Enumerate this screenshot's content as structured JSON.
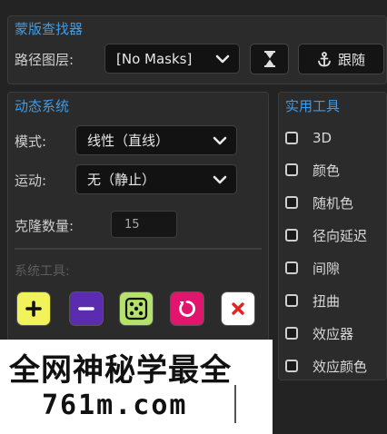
{
  "mask_finder": {
    "title": "蒙版查找器",
    "path_layer_label": "路径图层:",
    "path_layer_value": "[No Masks]",
    "follow_button": "跟随"
  },
  "dynamics": {
    "title": "动态系统",
    "mode_label": "模式:",
    "mode_value": "线性（直线）",
    "motion_label": "运动:",
    "motion_value": "无（静止）",
    "clone_label": "克隆数量:",
    "clone_value": "15",
    "system_tools_label": "系统工具:"
  },
  "tools": {
    "title": "实用工具",
    "items": [
      {
        "label": "3D"
      },
      {
        "label": "颜色"
      },
      {
        "label": "随机色"
      },
      {
        "label": "径向延迟"
      },
      {
        "label": "间隙"
      },
      {
        "label": "扭曲"
      },
      {
        "label": "效应器"
      },
      {
        "label": "效应颜色"
      }
    ]
  },
  "tool_buttons": [
    {
      "icon": "plus-icon",
      "color": "#f2f25a"
    },
    {
      "icon": "minus-icon",
      "color": "#5b2bb0"
    },
    {
      "icon": "dice-icon",
      "color": "#b4e26a"
    },
    {
      "icon": "refresh-icon",
      "color": "#e0156e"
    },
    {
      "icon": "close-icon",
      "color": "#ffffff"
    }
  ],
  "watermark": {
    "line1": "全网神秘学最全",
    "line2": "761m.com"
  }
}
